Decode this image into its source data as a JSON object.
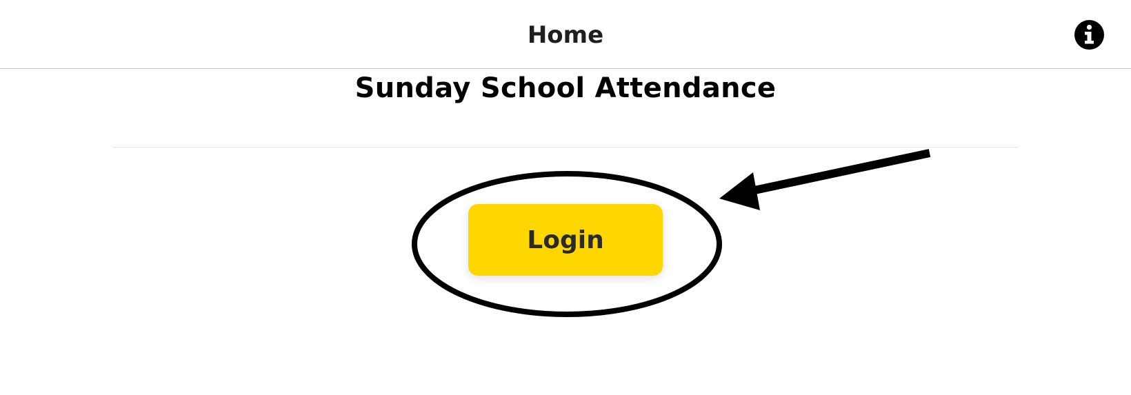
{
  "header": {
    "title": "Home",
    "info_icon": "info-icon"
  },
  "main": {
    "title": "Sunday School Attendance",
    "login_label": "Login"
  },
  "colors": {
    "accent": "#ffd600",
    "text": "#1f1f1f",
    "annotation": "#000000"
  }
}
